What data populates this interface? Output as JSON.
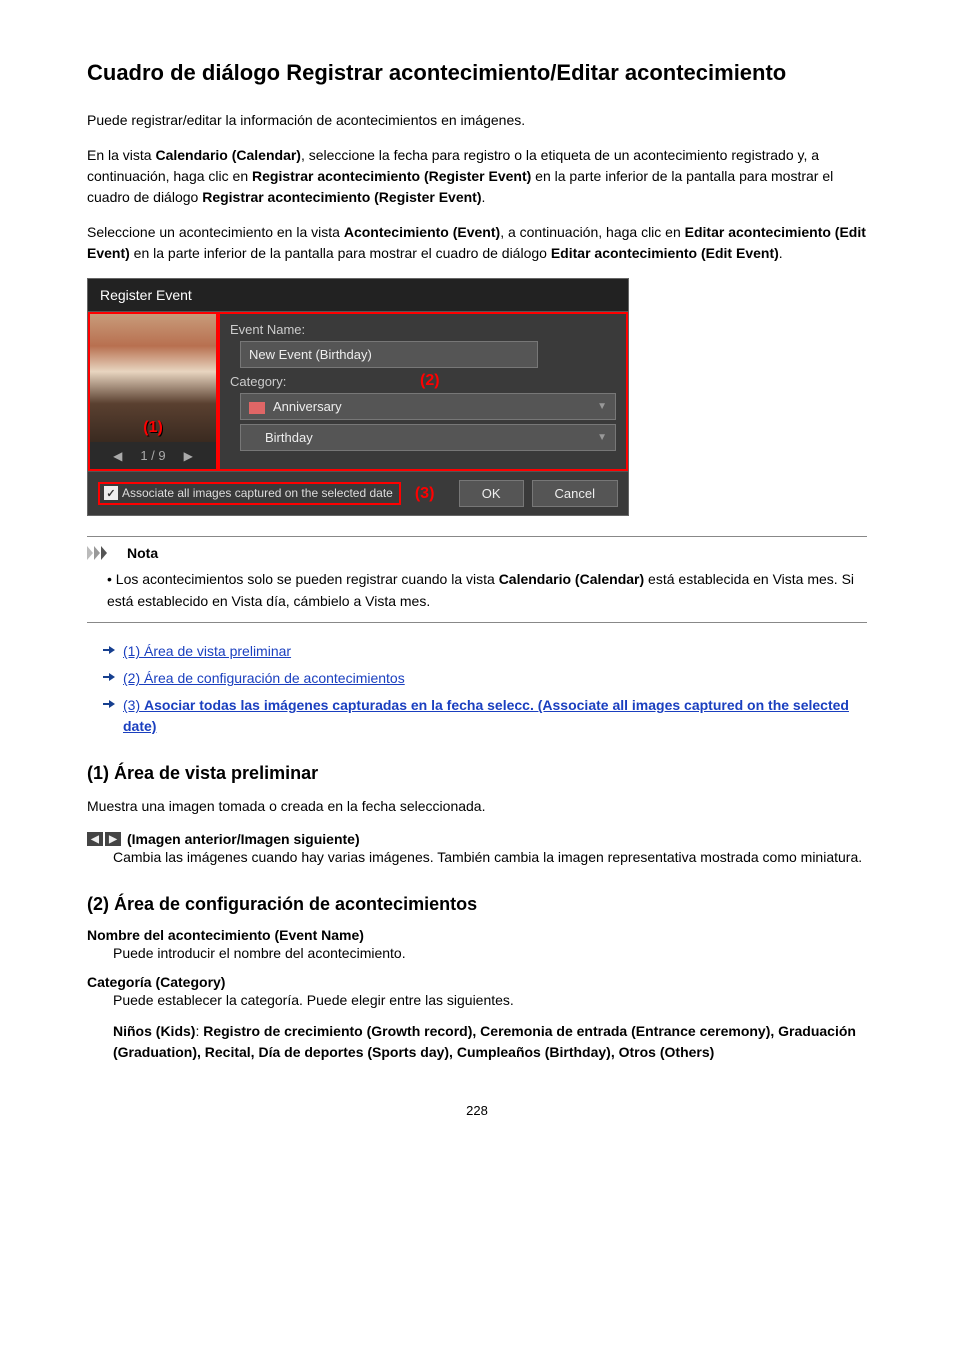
{
  "title": "Cuadro de diálogo Registrar acontecimiento/Editar acontecimiento",
  "intro": "Puede registrar/editar la información de acontecimientos en imágenes.",
  "p2a": "En la vista ",
  "p2b": "Calendario (Calendar)",
  "p2c": ", seleccione la fecha para registro o la etiqueta de un acontecimiento registrado y, a continuación, haga clic en ",
  "p2d": "Registrar acontecimiento (Register Event)",
  "p2e": " en la parte inferior de la pantalla para mostrar el cuadro de diálogo ",
  "p2f": "Registrar acontecimiento (Register Event)",
  "p2g": ".",
  "p3a": "Seleccione un acontecimiento en la vista ",
  "p3b": "Acontecimiento (Event)",
  "p3c": ", a continuación, haga clic en ",
  "p3d": "Editar acontecimiento (Edit Event)",
  "p3e": " en la parte inferior de la pantalla para mostrar el cuadro de diálogo ",
  "p3f": "Editar acontecimiento (Edit Event)",
  "p3g": ".",
  "screenshot": {
    "title": "Register Event",
    "pager": "1 / 9",
    "annot1": "(1)",
    "annot2": "(2)",
    "annot3": "(3)",
    "eventNameLabel": "Event Name:",
    "eventNameValue": "New Event (Birthday)",
    "categoryLabel": "Category:",
    "categoryValue": "Anniversary",
    "subCategoryValue": "Birthday",
    "checkboxText": "Associate all images captured on the selected date",
    "okBtn": "OK",
    "cancelBtn": "Cancel"
  },
  "note": {
    "heading": "Nota",
    "text1": "Los acontecimientos solo se pueden registrar cuando la vista ",
    "text2": "Calendario (Calendar)",
    "text3": " está establecida en Vista mes. Si está establecido en Vista día, cámbielo a Vista mes."
  },
  "links": {
    "l1": "(1) Área de vista preliminar",
    "l2": "(2) Área de configuración de acontecimientos",
    "l3a": "(3) ",
    "l3b": "Asociar todas las imágenes capturadas en la fecha selecc. (Associate all images captured on the selected date)"
  },
  "sec1": {
    "heading": "(1) Área de vista preliminar",
    "body": "Muestra una imagen tomada o creada en la fecha seleccionada.",
    "iconLabel": "(Imagen anterior/Imagen siguiente)",
    "iconBody": "Cambia las imágenes cuando hay varias imágenes. También cambia la imagen representativa mostrada como miniatura."
  },
  "sec2": {
    "heading": "(2) Área de configuración de acontecimientos",
    "t1": "Nombre del acontecimiento (Event Name)",
    "b1": "Puede introducir el nombre del acontecimiento.",
    "t2": "Categoría (Category)",
    "b2": "Puede establecer la categoría. Puede elegir entre las siguientes.",
    "listA": "Niños (Kids)",
    "listSep": ": ",
    "listItems": "Registro de crecimiento (Growth record), Ceremonia de entrada (Entrance ceremony), Graduación (Graduation), Recital, Día de deportes (Sports day), Cumpleaños (Birthday), Otros (Others)"
  },
  "pageNumber": "228"
}
